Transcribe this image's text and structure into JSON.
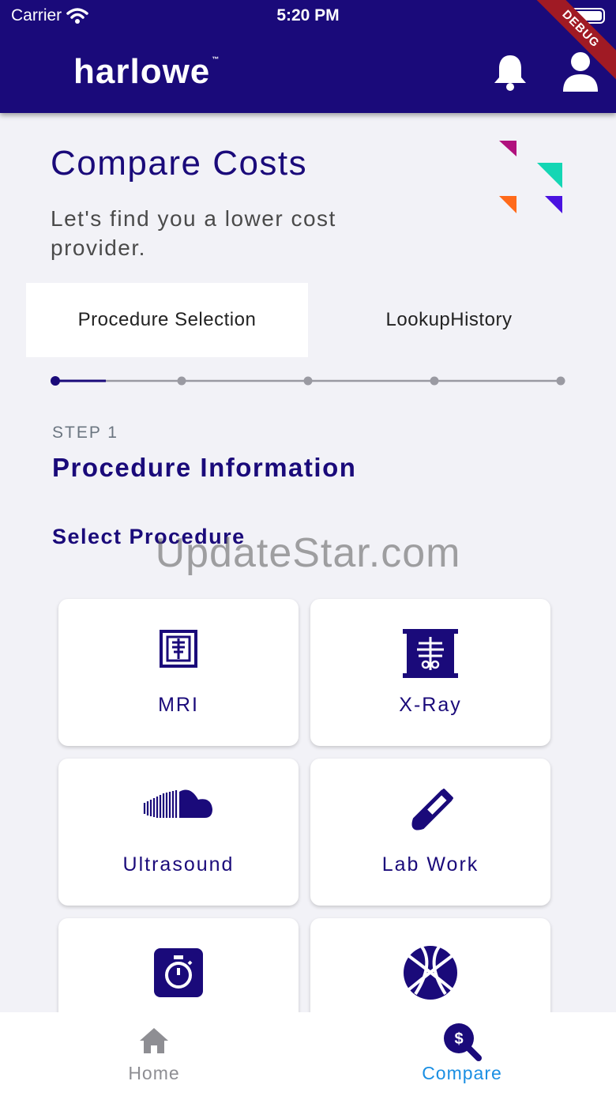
{
  "status_bar": {
    "carrier": "Carrier",
    "time": "5:20 PM"
  },
  "header": {
    "logo": "harlowe",
    "logo_tm": "™",
    "debug_badge": "DEBUG",
    "brand_color": "#1a0a7a"
  },
  "page": {
    "title": "Compare Costs",
    "subtitle": "Let's find you a lower cost provider."
  },
  "tabs": [
    {
      "label": "Procedure Selection",
      "active": true
    },
    {
      "label": "LookupHistory",
      "active": false
    }
  ],
  "stepper": {
    "total_steps": 5,
    "current_step": 1
  },
  "step": {
    "label": "STEP 1",
    "title": "Procedure Information",
    "select_title": "Select Procedure"
  },
  "watermark": "UpdateStar.com",
  "procedures": [
    {
      "label": "MRI",
      "icon": "mri-icon"
    },
    {
      "label": "X-Ray",
      "icon": "xray-icon"
    },
    {
      "label": "Ultrasound",
      "icon": "ultrasound-icon"
    },
    {
      "label": "Lab Work",
      "icon": "test-tube-icon"
    },
    {
      "label": "",
      "icon": "stopwatch-icon"
    },
    {
      "label": "",
      "icon": "basketball-icon"
    }
  ],
  "bottom_nav": [
    {
      "label": "Home",
      "icon": "home-icon",
      "active": false,
      "color": "#8e8e93"
    },
    {
      "label": "Compare",
      "icon": "dollar-search-icon",
      "active": true,
      "color": "#1a8fe3"
    }
  ]
}
